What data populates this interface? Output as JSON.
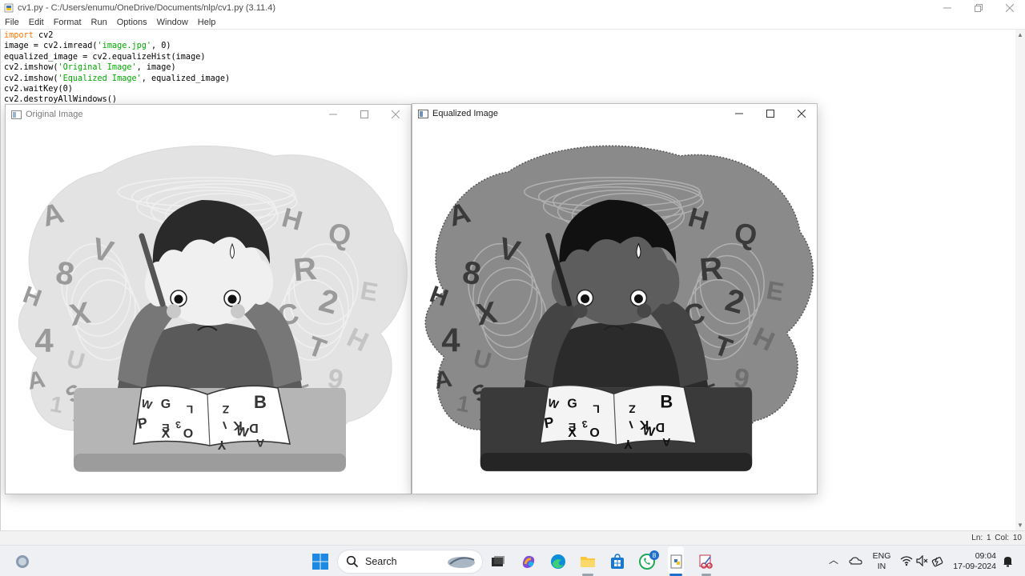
{
  "idle": {
    "title": "cv1.py - C:/Users/enumu/OneDrive/Documents/nlp/cv1.py (3.11.4)",
    "menus": [
      "File",
      "Edit",
      "Format",
      "Run",
      "Options",
      "Window",
      "Help"
    ],
    "code": {
      "l1_kw": "import",
      "l1_rest": " cv2",
      "l2_a": "image = cv2.imread(",
      "l2_s": "'image.jpg'",
      "l2_b": ", 0)",
      "l3": "equalized_image = cv2.equalizeHist(image)",
      "l4_a": "cv2.imshow(",
      "l4_s": "'Original Image'",
      "l4_b": ", image)",
      "l5_a": "cv2.imshow(",
      "l5_s": "'Equalized Image'",
      "l5_b": ", equalized_image)",
      "l6": "cv2.waitKey(0)",
      "l7": "cv2.destroyAllWindows()"
    },
    "status": "Ln: 1   Col: 10"
  },
  "windows": {
    "original": {
      "title": "Original Image"
    },
    "equalized": {
      "title": "Equalized Image"
    }
  },
  "image_letters": {
    "around": [
      "A",
      "V",
      "8",
      "H",
      "X",
      "4",
      "U",
      "A",
      "1",
      "S",
      "Z",
      "E",
      "H",
      "Q",
      "R",
      "2",
      "E",
      "C",
      "T",
      "H",
      "9",
      "L",
      "5",
      "W"
    ],
    "book_left": [
      "W",
      "G",
      "L",
      "P",
      "E",
      "3",
      "X",
      "O"
    ],
    "book_right": [
      "Z",
      "B",
      "K",
      "I",
      "D",
      "Y",
      "W",
      "A"
    ]
  },
  "taskbar": {
    "search_label": "Search",
    "whatsapp_badge": "8",
    "lang_line1": "ENG",
    "lang_line2": "IN",
    "time": "09:04",
    "date": "17-09-2024"
  },
  "colors": {
    "python_keyword": "#ff7700",
    "python_string": "#00aa00",
    "taskbar_bg": "#eef0f4"
  }
}
